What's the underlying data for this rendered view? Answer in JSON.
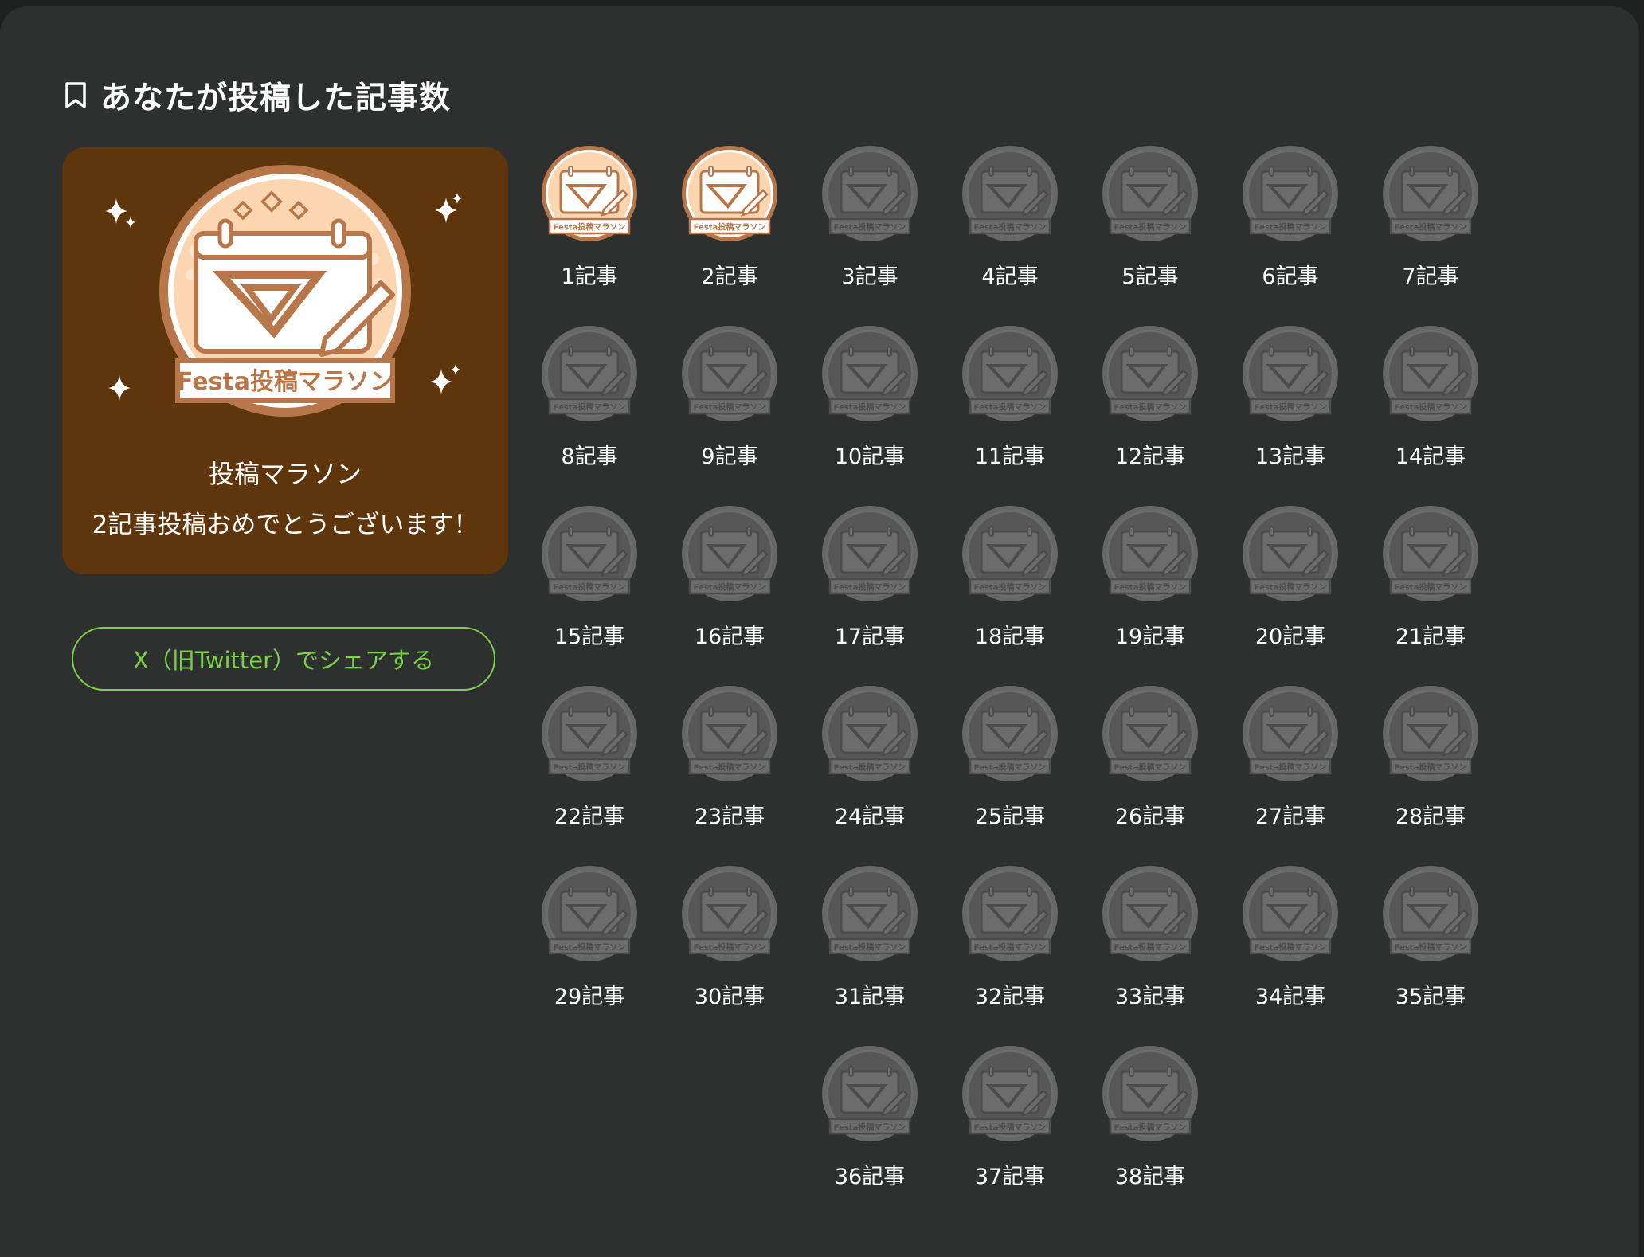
{
  "section": {
    "title": "あなたが投稿した記事数"
  },
  "featured": {
    "badge_text": "Festa投稿マラソン",
    "title": "投稿マラソン",
    "message": "2記事投稿おめでとうございます！"
  },
  "share_button": {
    "label": "X（旧Twitter）でシェアする"
  },
  "badges": [
    {
      "label": "1記事",
      "earned": true
    },
    {
      "label": "2記事",
      "earned": true
    },
    {
      "label": "3記事",
      "earned": false
    },
    {
      "label": "4記事",
      "earned": false
    },
    {
      "label": "5記事",
      "earned": false
    },
    {
      "label": "6記事",
      "earned": false
    },
    {
      "label": "7記事",
      "earned": false
    },
    {
      "label": "8記事",
      "earned": false
    },
    {
      "label": "9記事",
      "earned": false
    },
    {
      "label": "10記事",
      "earned": false
    },
    {
      "label": "11記事",
      "earned": false
    },
    {
      "label": "12記事",
      "earned": false
    },
    {
      "label": "13記事",
      "earned": false
    },
    {
      "label": "14記事",
      "earned": false
    },
    {
      "label": "15記事",
      "earned": false
    },
    {
      "label": "16記事",
      "earned": false
    },
    {
      "label": "17記事",
      "earned": false
    },
    {
      "label": "18記事",
      "earned": false
    },
    {
      "label": "19記事",
      "earned": false
    },
    {
      "label": "20記事",
      "earned": false
    },
    {
      "label": "21記事",
      "earned": false
    },
    {
      "label": "22記事",
      "earned": false
    },
    {
      "label": "23記事",
      "earned": false
    },
    {
      "label": "24記事",
      "earned": false
    },
    {
      "label": "25記事",
      "earned": false
    },
    {
      "label": "26記事",
      "earned": false
    },
    {
      "label": "27記事",
      "earned": false
    },
    {
      "label": "28記事",
      "earned": false
    },
    {
      "label": "29記事",
      "earned": false
    },
    {
      "label": "30記事",
      "earned": false
    },
    {
      "label": "31記事",
      "earned": false
    },
    {
      "label": "32記事",
      "earned": false
    },
    {
      "label": "33記事",
      "earned": false
    },
    {
      "label": "34記事",
      "earned": false
    },
    {
      "label": "35記事",
      "earned": false
    },
    {
      "label": "36記事",
      "earned": false
    },
    {
      "label": "37記事",
      "earned": false
    },
    {
      "label": "38記事",
      "earned": false
    }
  ],
  "colors": {
    "background": "#2e3030",
    "featured_card": "#5f360b",
    "accent_green": "#7bd14a",
    "badge_earned_ring": "#b8774a",
    "badge_earned_fill": "#fbd6b0",
    "badge_locked": "#5a5a5a"
  },
  "icons": {
    "heading": "bookmark-icon",
    "badge": "calendar-pen-badge-icon",
    "decoration": "sparkle-icon"
  }
}
